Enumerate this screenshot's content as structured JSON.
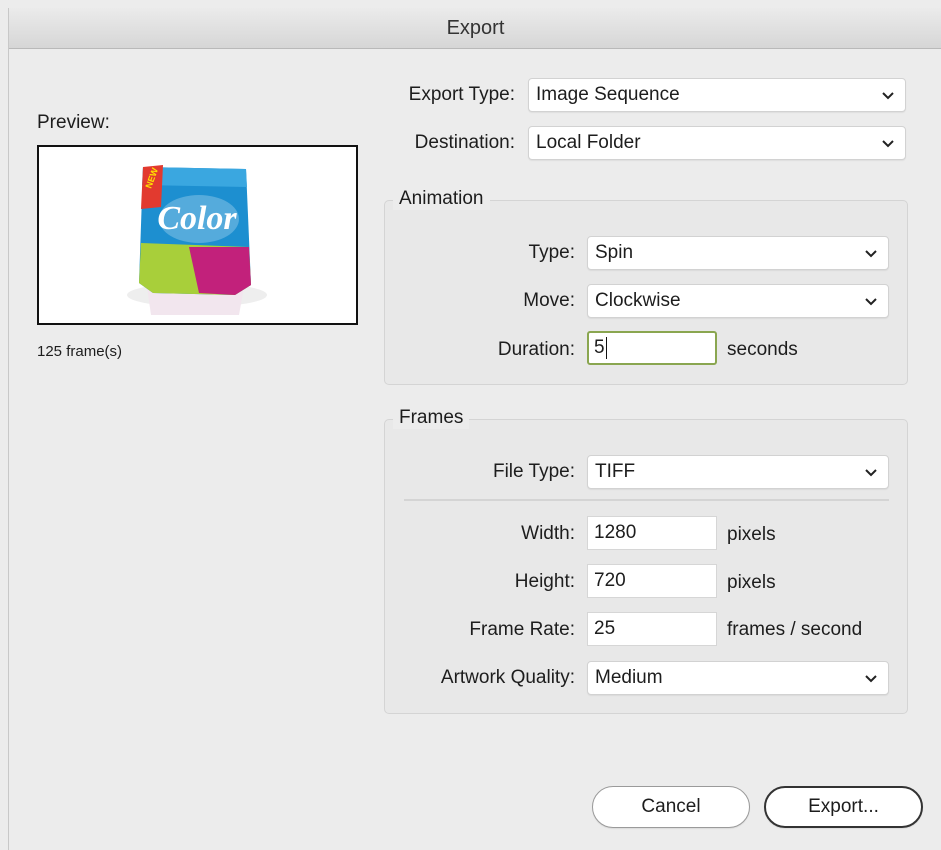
{
  "window": {
    "title": "Export"
  },
  "preview": {
    "label": "Preview:",
    "frames": "125 frame(s)",
    "product_text": "Color",
    "badge_text": "NEW"
  },
  "export_type": {
    "label": "Export Type:",
    "value": "Image Sequence"
  },
  "destination": {
    "label": "Destination:",
    "value": "Local Folder"
  },
  "animation": {
    "title": "Animation",
    "type": {
      "label": "Type:",
      "value": "Spin"
    },
    "move": {
      "label": "Move:",
      "value": "Clockwise"
    },
    "duration": {
      "label": "Duration:",
      "value": "5",
      "unit": "seconds"
    }
  },
  "frames": {
    "title": "Frames",
    "file_type": {
      "label": "File Type:",
      "value": "TIFF"
    },
    "width": {
      "label": "Width:",
      "value": "1280",
      "unit": "pixels"
    },
    "height": {
      "label": "Height:",
      "value": "720",
      "unit": "pixels"
    },
    "frame_rate": {
      "label": "Frame Rate:",
      "value": "25",
      "unit": "frames / second"
    },
    "artwork_quality": {
      "label": "Artwork Quality:",
      "value": "Medium"
    }
  },
  "buttons": {
    "cancel": "Cancel",
    "export": "Export..."
  },
  "colors": {
    "focus_ring": "#8aa650",
    "window_bg": "#ececec"
  }
}
